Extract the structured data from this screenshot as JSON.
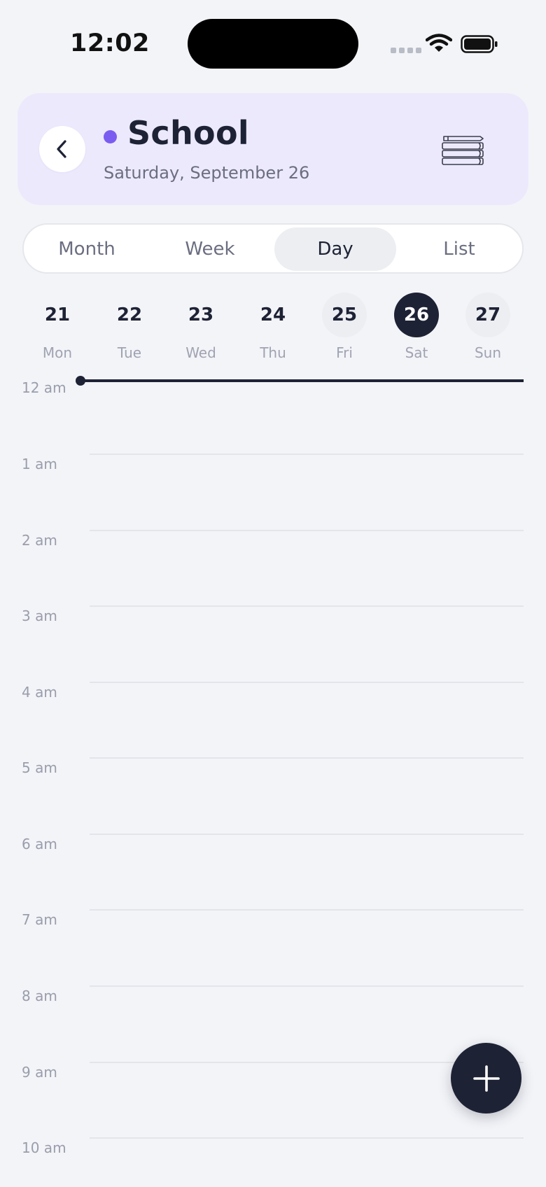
{
  "status_bar": {
    "time": "12:02"
  },
  "header": {
    "title": "School",
    "date": "Saturday, September 26",
    "accent_color": "#7b5cf0",
    "card_color": "#ece9fd",
    "icon": "books-icon"
  },
  "view_tabs": [
    {
      "label": "Month",
      "active": false
    },
    {
      "label": "Week",
      "active": false
    },
    {
      "label": "Day",
      "active": true
    },
    {
      "label": "List",
      "active": false
    }
  ],
  "days": [
    {
      "num": "21",
      "label": "Mon",
      "state": "plain"
    },
    {
      "num": "22",
      "label": "Tue",
      "state": "plain"
    },
    {
      "num": "23",
      "label": "Wed",
      "state": "plain"
    },
    {
      "num": "24",
      "label": "Thu",
      "state": "plain"
    },
    {
      "num": "25",
      "label": "Fri",
      "state": "soft"
    },
    {
      "num": "26",
      "label": "Sat",
      "state": "selected"
    },
    {
      "num": "27",
      "label": "Sun",
      "state": "soft"
    }
  ],
  "hours": [
    "12 am",
    "1 am",
    "2 am",
    "3 am",
    "4 am",
    "5 am",
    "6 am",
    "7 am",
    "8 am",
    "9 am",
    "10 am"
  ],
  "fab": {
    "icon": "plus-icon"
  }
}
